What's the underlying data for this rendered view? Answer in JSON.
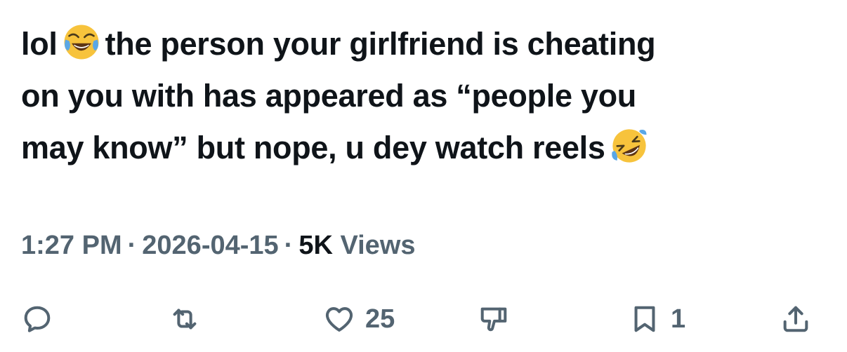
{
  "tweet": {
    "line1_a": "lol",
    "line1_b": "the person your girlfriend is cheating",
    "line2": "on you with has appeared as “people you",
    "line3": "may know” but nope, u dey watch reels",
    "emoji1": "face-with-tears-of-joy",
    "emoji2": "rolling-on-the-floor-laughing"
  },
  "meta": {
    "time": "1:27 PM",
    "separator": "·",
    "date": "2026-04-15",
    "views_count": "5K",
    "views_label": "Views"
  },
  "actions": {
    "reply_icon": "reply-icon",
    "retweet_icon": "retweet-icon",
    "like_icon": "heart-icon",
    "like_count": "25",
    "dislike_icon": "thumbs-down-icon",
    "bookmark_icon": "bookmark-icon",
    "bookmark_count": "1",
    "share_icon": "share-icon"
  },
  "colors": {
    "text": "#0f1419",
    "secondary": "#536471",
    "emoji_yellow": "#f7c33c",
    "emoji_tears": "#5aa7e6"
  }
}
